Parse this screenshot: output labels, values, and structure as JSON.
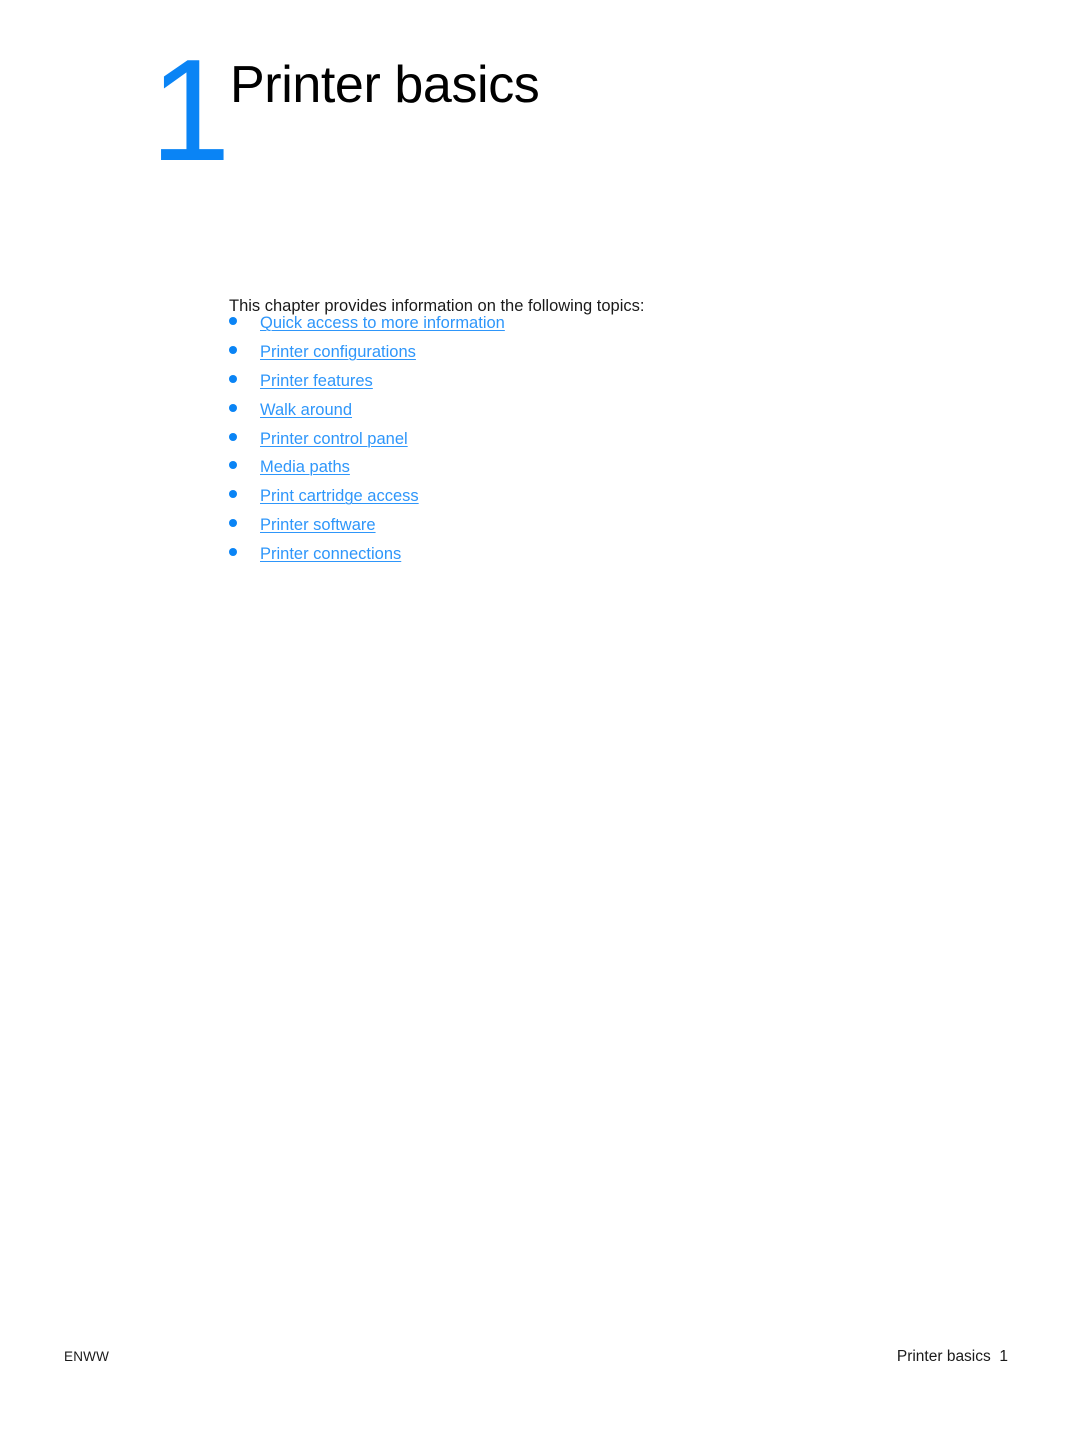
{
  "document": {
    "chapter": {
      "number": "1",
      "title": "Printer basics",
      "number_color": "#0a84f5"
    },
    "intro": "This chapter provides information on the following topics:",
    "topics": [
      {
        "label": "Quick access to more information"
      },
      {
        "label": "Printer configurations"
      },
      {
        "label": "Printer features"
      },
      {
        "label": "Walk around"
      },
      {
        "label": "Printer control panel"
      },
      {
        "label": "Media paths"
      },
      {
        "label": "Print cartridge access"
      },
      {
        "label": "Printer software"
      },
      {
        "label": "Printer connections"
      }
    ],
    "link_color": "#2e96fa",
    "footer": {
      "left": "ENWW",
      "right": "Printer basics  1",
      "chapter_title": "Printer basics",
      "page_number": "1"
    }
  }
}
